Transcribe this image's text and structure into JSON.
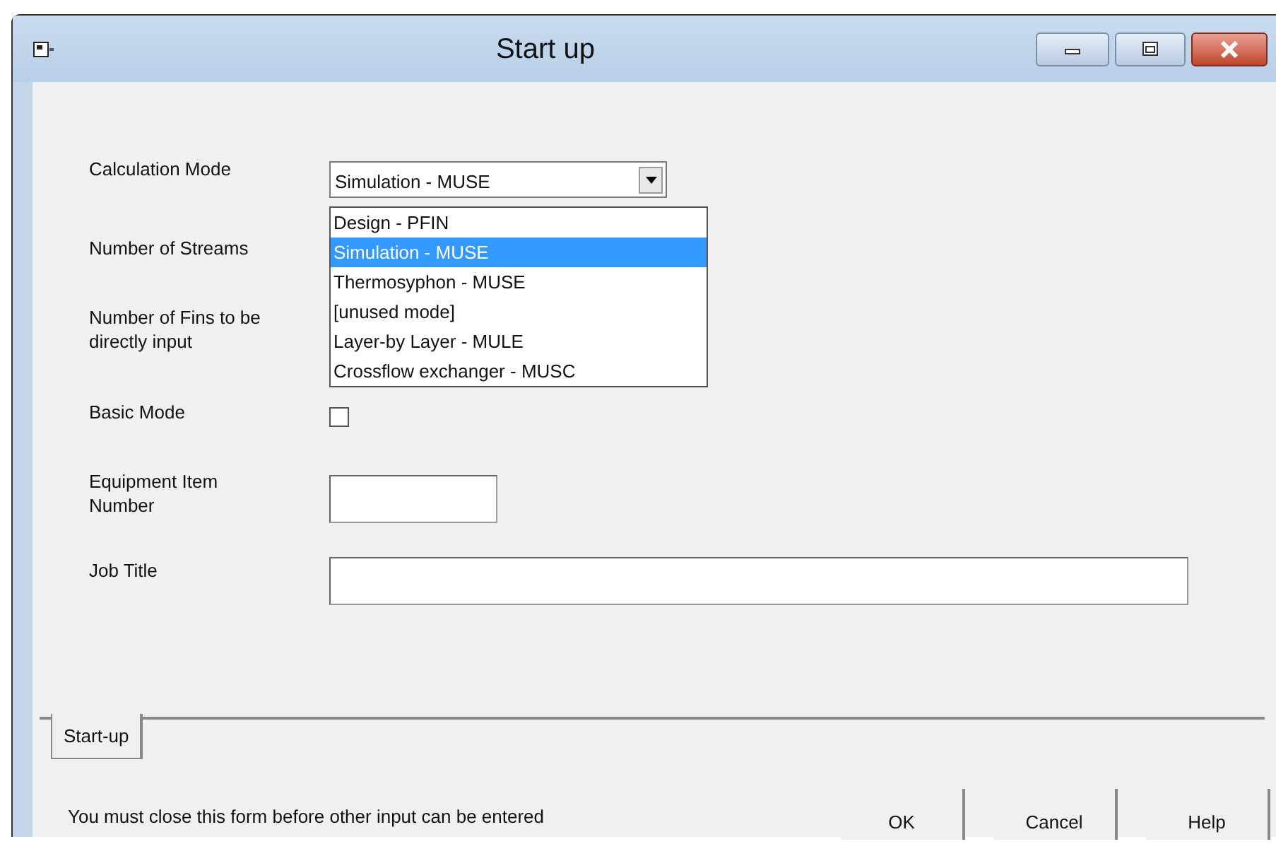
{
  "window": {
    "title": "Start up"
  },
  "form": {
    "calculation_mode": {
      "label": "Calculation Mode",
      "value": "Simulation - MUSE",
      "expanded": true,
      "options": [
        {
          "label": "Design - PFIN",
          "selected": false
        },
        {
          "label": "Simulation - MUSE",
          "selected": true
        },
        {
          "label": "Thermosyphon - MUSE",
          "selected": false
        },
        {
          "label": "[unused mode]",
          "selected": false
        },
        {
          "label": "Layer-by Layer - MULE",
          "selected": false
        },
        {
          "label": "Crossflow exchanger - MUSC",
          "selected": false
        }
      ]
    },
    "number_of_streams": {
      "label": "Number of Streams"
    },
    "fins_input": {
      "label": "Number of Fins to be directly input"
    },
    "basic_mode": {
      "label": "Basic Mode",
      "checked": false
    },
    "equipment_item_number": {
      "label": "Equipment Item Number"
    },
    "job_title": {
      "label": "Job Title"
    }
  },
  "tabs": [
    {
      "label": "Start-up",
      "selected": true
    }
  ],
  "status_bar": {
    "text": "You must close this form before other input can be entered"
  },
  "buttons": [
    "OK",
    "Cancel",
    "Help"
  ]
}
